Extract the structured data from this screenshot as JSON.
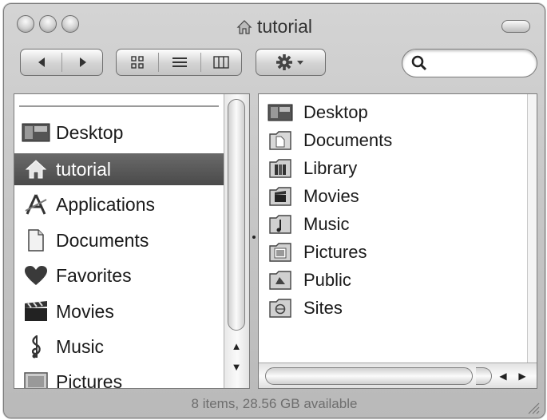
{
  "window": {
    "title": "tutorial",
    "status": "8 items, 28.56 GB available"
  },
  "toolbar": {
    "back_icon": "back-arrow-icon",
    "forward_icon": "forward-arrow-icon",
    "view_modes": [
      "icon-view",
      "list-view",
      "column-view"
    ],
    "action_icon": "gear-icon",
    "search_placeholder": ""
  },
  "sidebar": {
    "items": [
      {
        "label": "Desktop",
        "icon": "desktop-icon"
      },
      {
        "label": "tutorial",
        "icon": "home-icon",
        "selected": true
      },
      {
        "label": "Applications",
        "icon": "applications-icon"
      },
      {
        "label": "Documents",
        "icon": "document-icon"
      },
      {
        "label": "Favorites",
        "icon": "heart-icon"
      },
      {
        "label": "Movies",
        "icon": "clapperboard-icon"
      },
      {
        "label": "Music",
        "icon": "music-note-icon"
      },
      {
        "label": "Pictures",
        "icon": "pictures-icon"
      }
    ]
  },
  "content": {
    "items": [
      {
        "label": "Desktop",
        "icon": "desktop-folder-icon"
      },
      {
        "label": "Documents",
        "icon": "documents-folder-icon"
      },
      {
        "label": "Library",
        "icon": "library-folder-icon"
      },
      {
        "label": "Movies",
        "icon": "movies-folder-icon"
      },
      {
        "label": "Music",
        "icon": "music-folder-icon"
      },
      {
        "label": "Pictures",
        "icon": "pictures-folder-icon"
      },
      {
        "label": "Public",
        "icon": "public-folder-icon"
      },
      {
        "label": "Sites",
        "icon": "sites-folder-icon"
      }
    ]
  },
  "colors": {
    "selection": "#555555",
    "chrome": "#c6c6c6",
    "text": "#1a1a1a"
  }
}
